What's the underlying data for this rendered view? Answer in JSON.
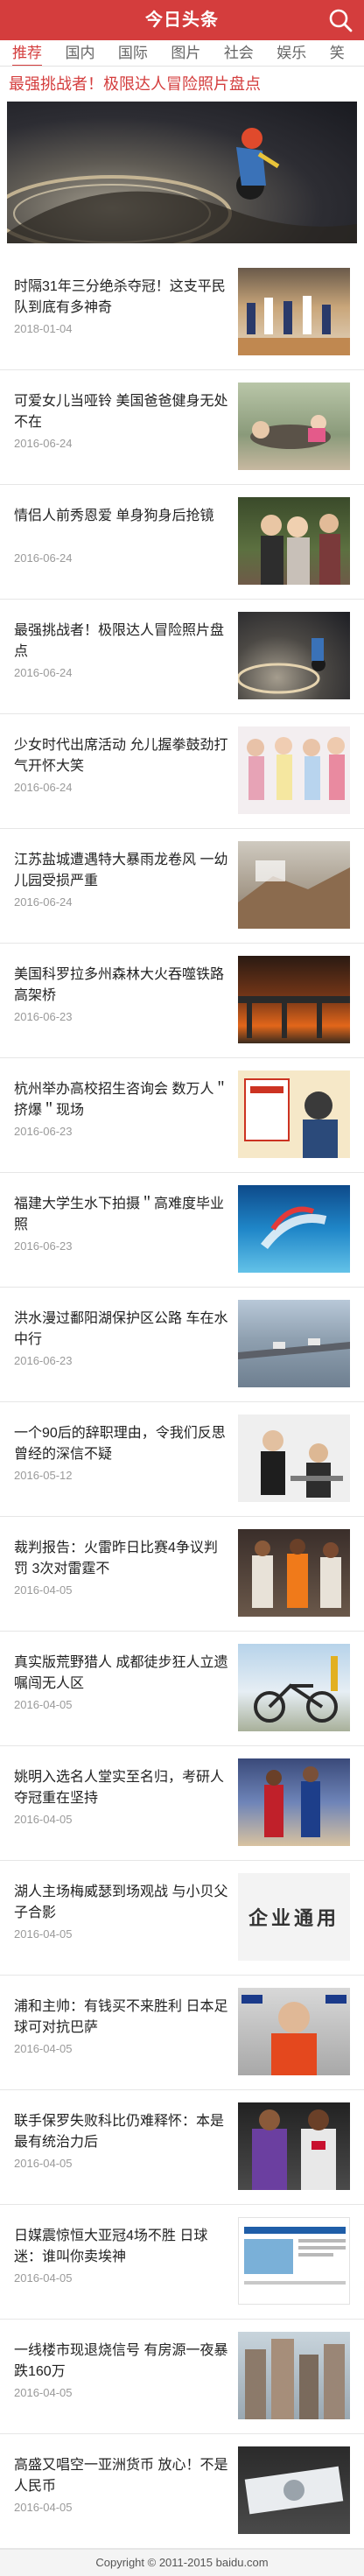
{
  "header": {
    "logo": "今日头条",
    "search_icon": "search-icon",
    "brand_color": "#d43d3d"
  },
  "tabs": [
    {
      "label": "推荐",
      "active": true
    },
    {
      "label": "国内"
    },
    {
      "label": "国际"
    },
    {
      "label": "图片"
    },
    {
      "label": "社会"
    },
    {
      "label": "娱乐"
    },
    {
      "label": "笑"
    }
  ],
  "featured": {
    "title": "最强挑战者！极限达人冒险照片盘点"
  },
  "news": [
    {
      "title": "时隔31年三分绝杀夺冠！这支平民队到底有多神奇",
      "date": "2018-01-04"
    },
    {
      "title": "可爱女儿当哑铃 美国爸爸健身无处不在",
      "date": "2016-06-24"
    },
    {
      "title": "情侣人前秀恩爱 单身狗身后抢镜",
      "date": "2016-06-24"
    },
    {
      "title": "最强挑战者！极限达人冒险照片盘点",
      "date": "2016-06-24"
    },
    {
      "title": "少女时代出席活动 允儿握拳鼓劲打气开怀大笑",
      "date": "2016-06-24"
    },
    {
      "title": "江苏盐城遭遇特大暴雨龙卷风 一幼儿园受损严重",
      "date": "2016-06-24"
    },
    {
      "title": "美国科罗拉多州森林大火吞噬铁路高架桥",
      "date": "2016-06-23"
    },
    {
      "title": "杭州举办高校招生咨询会 数万人＂挤爆＂现场",
      "date": "2016-06-23"
    },
    {
      "title": "福建大学生水下拍摄＂高难度毕业照",
      "date": "2016-06-23"
    },
    {
      "title": "洪水漫过鄱阳湖保护区公路 车在水中行",
      "date": "2016-06-23"
    },
    {
      "title": "一个90后的辞职理由，令我们反思曾经的深信不疑",
      "date": "2016-05-12"
    },
    {
      "title": "裁判报告：火雷昨日比赛4争议判罚 3次对雷霆不",
      "date": "2016-04-05"
    },
    {
      "title": "真实版荒野猎人 成都徒步狂人立遗嘱闯无人区",
      "date": "2016-04-05"
    },
    {
      "title": "姚明入选名人堂实至名归，考研人夺冠重在坚持",
      "date": "2016-04-05"
    },
    {
      "title": "湖人主场梅威瑟到场观战 与小贝父子合影",
      "date": "2016-04-05"
    },
    {
      "title": "浦和主帅：有钱买不来胜利 日本足球可对抗巴萨",
      "date": "2016-04-05"
    },
    {
      "title": "联手保罗失败科比仍难释怀：本是最有统治力后",
      "date": "2016-04-05"
    },
    {
      "title": "日媒震惊恒大亚冠4场不胜 日球迷：谁叫你卖埃神",
      "date": "2016-04-05"
    },
    {
      "title": "一线楼市现退烧信号 有房源一夜暴跌160万",
      "date": "2016-04-05"
    },
    {
      "title": "高盛又唱空一亚洲货币 放心！不是人民币",
      "date": "2016-04-05"
    }
  ],
  "thumb_placeholder_text": "企业通用",
  "footer": {
    "text": "Copyright © 2011-2015 baidu.com"
  }
}
